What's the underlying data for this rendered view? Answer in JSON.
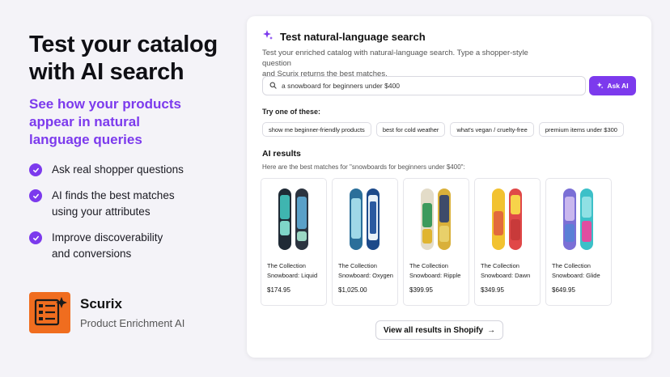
{
  "hero": {
    "title_line1": "Test your catalog",
    "title_line2": "with AI search",
    "subtitle_line1": "See how your products",
    "subtitle_line2": "appear in natural",
    "subtitle_line3": "language queries",
    "bullets": [
      {
        "line1": "Ask real shopper questions",
        "line2": ""
      },
      {
        "line1": "AI finds the best matches",
        "line2": "using your attributes"
      },
      {
        "line1": "Improve discoverability",
        "line2": "and conversions"
      }
    ]
  },
  "brand": {
    "name": "Scurix",
    "tagline": "Product Enrichment AI",
    "color": "#f06d1f"
  },
  "card": {
    "title": "Test natural-language search",
    "desc_line1": "Test your enriched catalog with natural-language search. Type a shopper-style question",
    "desc_line2": "and Scurix returns the best matches.",
    "search_value": "a snowboard for beginners under $400",
    "ask_label": "Ask AI",
    "try_label": "Try one of these:",
    "chips": [
      "show me beginner-friendly products",
      "best for cold weather",
      "what's vegan / cruelty-free",
      "premium items under $300"
    ],
    "results_title": "AI results",
    "results_desc": "Here are the best matches for \"snowboards for beginners under $400\":",
    "products": [
      {
        "name_line1": "The Collection",
        "name_line2": "Snowboard: Liquid",
        "price": "$174.95"
      },
      {
        "name_line1": "The Collection",
        "name_line2": "Snowboard: Oxygen",
        "price": "$1,025.00"
      },
      {
        "name_line1": "The Collection",
        "name_line2": "Snowboard: Ripple",
        "price": "$399.95"
      },
      {
        "name_line1": "The Collection",
        "name_line2": "Snowboard: Dawn",
        "price": "$349.95"
      },
      {
        "name_line1": "The Collection",
        "name_line2": "Snowboard: Glide",
        "price": "$649.95"
      }
    ],
    "view_all_label": "View all results in Shopify",
    "view_all_arrow": "→"
  },
  "colors": {
    "accent": "#7c3aed",
    "background": "#f4f3f8"
  },
  "icons": {
    "sparkle": "sparkle-icon",
    "search": "search-icon",
    "check": "check-circle-icon",
    "logo": "scurix-logo-icon"
  }
}
